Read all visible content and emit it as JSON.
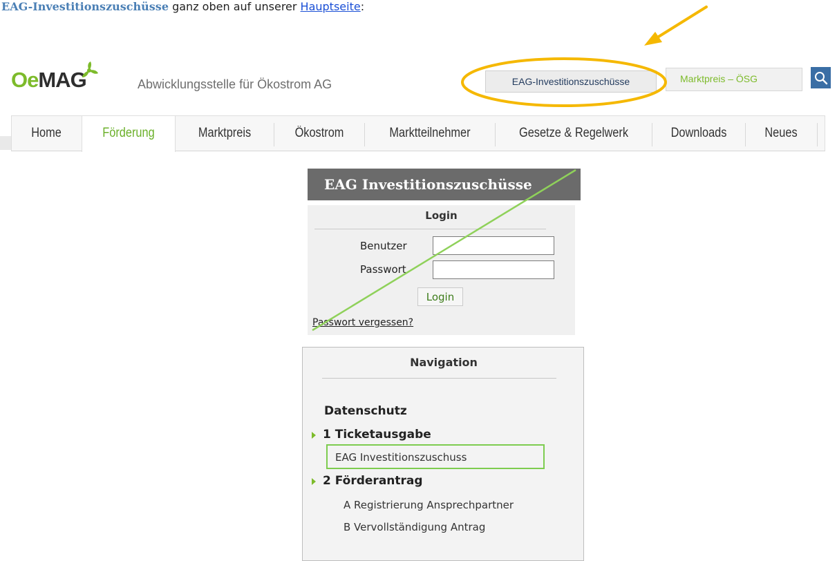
{
  "intro": {
    "highlight": "EAG-Investitionszuschüsse",
    "middle": " ganz oben auf unserer ",
    "link": "Hauptseite",
    "end": ":"
  },
  "header": {
    "logo_oe": "Oe",
    "logo_mag": "MAG",
    "tagline": "Abwicklungsstelle für Ökostrom AG",
    "eag_button": "EAG-Investitionszuschüsse",
    "markt_button": "Marktpreis – ÖSG",
    "search_icon": "search-icon"
  },
  "nav": {
    "home": "Home",
    "foerderung": "Förderung",
    "marktpreis": "Marktpreis",
    "oekostrom": "Ökostrom",
    "marktteilnehmer": "Marktteilnehmer",
    "gesetze": "Gesetze & Regelwerk",
    "downloads": "Downloads",
    "neues": "Neues",
    "active": "Förderung"
  },
  "panel": {
    "title": "EAG Investitionszuschüsse",
    "login": {
      "title": "Login",
      "user_label": "Benutzer",
      "user_value": "",
      "pass_label": "Passwort",
      "pass_value": "",
      "button": "Login",
      "forgot": "Passwort vergessen?"
    },
    "navigation": {
      "title": "Navigation",
      "datenschutz": "Datenschutz",
      "ticket": "1 Ticketausgabe",
      "ticket_sub": "EAG Investitionszuschuss",
      "antrag": "2 Förderantrag",
      "antrag_a": "A Registrierung Ansprechpartner",
      "antrag_b": "B Vervollständigung Antrag"
    }
  },
  "colors": {
    "brand_green": "#7dbb2b",
    "annotation_orange": "#f5b800",
    "highlight_green": "#7dcc4f",
    "panel_gray": "#6b6b6b",
    "search_blue": "#3a6ea5"
  }
}
